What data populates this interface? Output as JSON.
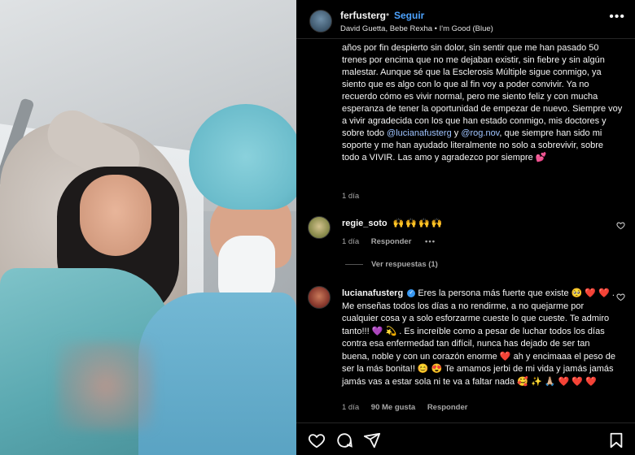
{
  "post": {
    "username": "ferfusterg",
    "separator": "•",
    "follow_label": "Seguir",
    "music": "David Guetta, Bebe Rexha • I'm Good (Blue)",
    "more_label": "•••"
  },
  "caption": {
    "text_1": "años por fin despierto sin dolor, sin sentir que me han pasado 50 trenes por encima que no me dejaban existir, sin fiebre y sin algún malestar. Aunque sé que la Esclerosis Múltiple sigue conmigo, ya siento que es algo con lo que al fin voy a poder convivir. Ya no recuerdo cómo es vivir normal, pero me siento feliz y con mucha esperanza de tener la oportunidad de empezar de nuevo. Siempre voy a vivir agradecida con los que han estado conmigo, mis doctores y sobre todo",
    "mention_1": "@lucianafusterg",
    "text_2": "y",
    "mention_2": "@rog.nov",
    "text_3": ", que siempre han sido mi soporte y me han ayudado literalmente no solo a sobrevivir, sobre todo a VIVIR. Las amo y agradezco por siempre",
    "emoji": "💕",
    "timestamp": "1 día"
  },
  "comments": [
    {
      "username": "regie_soto",
      "text": "🙌🙌🙌🙌",
      "timestamp": "1 día",
      "reply_label": "Responder",
      "more_label": "•••",
      "like_icon": "heart-outline-icon"
    },
    {
      "username": "lucianafusterg",
      "verified_mark": "✓",
      "text": "Eres la persona más fuerte que existe 🥺 ❤️ ❤️ . Me enseñas todos los días a no rendirme, a no quejarme por cualquier cosa y a solo esforzarme cueste lo que cueste. Te admiro tanto!!! 💜 💫 . Es increíble como a pesar de luchar todos los días contra esa enfermedad tan difícil, nunca has dejado de ser tan buena, noble y con un corazón enorme ❤️ ah y encimaaa el peso de ser la más bonita!! 😊 😍 Te amamos jerbi de mi vida y jamás jamás jamás vas a estar sola ni te va a faltar nada 🥰 ✨ 🙏🏼 ❤️ ❤️ ❤️",
      "timestamp": "1 día",
      "likes": "90 Me gusta",
      "reply_label": "Responder",
      "like_icon": "heart-outline-icon"
    }
  ],
  "view_replies": "Ver respuestas (1)",
  "actions": [
    "heart-outline-icon",
    "comment-icon",
    "share-icon",
    "bookmark-icon"
  ]
}
